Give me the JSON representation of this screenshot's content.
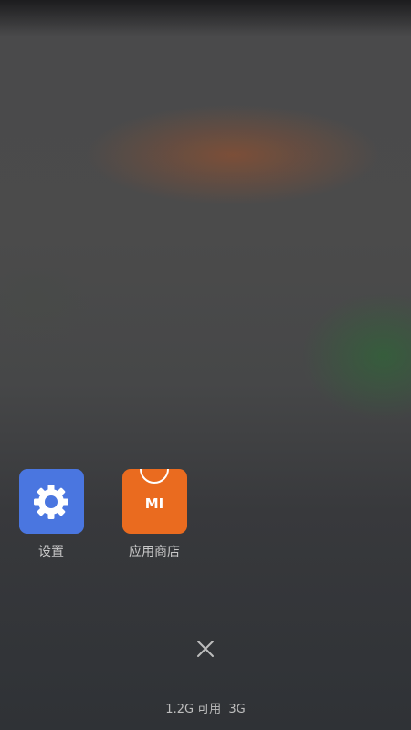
{
  "recent_apps": [
    {
      "label": "设置",
      "icon": "gear-icon",
      "color": "#4a76e0"
    },
    {
      "label": "应用商店",
      "icon": "mi-store-icon",
      "logo_text": "MI",
      "color": "#ea6b1f"
    }
  ],
  "close_button": {
    "icon": "close-icon"
  },
  "memory": {
    "available": "1.2G 可用",
    "total": "3G"
  }
}
